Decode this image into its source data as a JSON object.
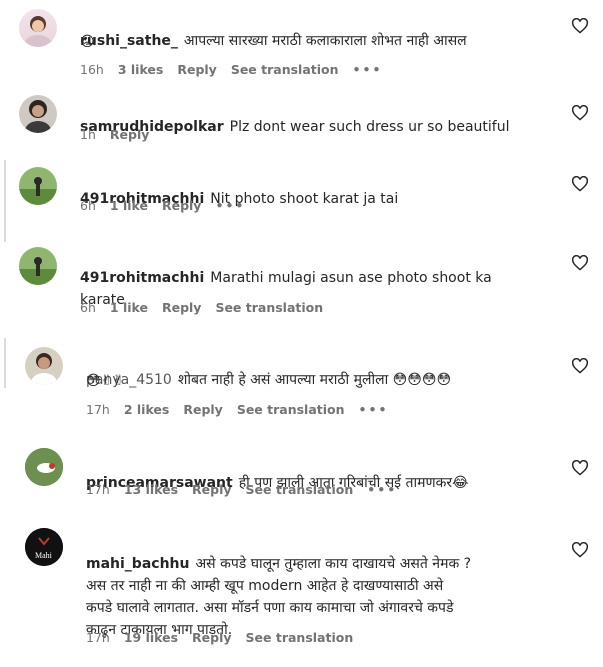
{
  "comments": [
    {
      "username": "rushi_sathe_",
      "text": "आपल्या सारख्या मराठी कलाकाराला शोभत नाही आसल",
      "emoji": "😡",
      "time": "16h",
      "likes": "3 likes",
      "reply": "Reply",
      "translate": "See translation",
      "more": "•••"
    },
    {
      "username": "samrudhidepolkar",
      "text": "Plz dont wear such dress ur so beautiful",
      "time": "1h",
      "reply": "Reply"
    },
    {
      "username": "491rohitmachhi",
      "text": "Nit photo shoot karat ja tai",
      "time": "6h",
      "likes": "1 like",
      "reply": "Reply",
      "more": "•••"
    },
    {
      "username": "491rohitmachhi",
      "text": "Marathi mulagi asun ase photo shoot ka\nkarate",
      "time": "6h",
      "likes": "1 like",
      "reply": "Reply",
      "translate": "See translation"
    },
    {
      "username": "panya_4510",
      "text": "शोबत नाही हे असं आपल्या मराठी मुलीला 😳😳😳😳",
      "emoji": "😳✌✌",
      "time": "17h",
      "likes": "2 likes",
      "reply": "Reply",
      "translate": "See translation",
      "more": "•••"
    },
    {
      "username": "princeamarsawant",
      "text": "ही पण झाली आता गरिबांची सई तामणकर😂",
      "time": "17h",
      "likes": "13 likes",
      "reply": "Reply",
      "translate": "See translation",
      "more": "•••"
    },
    {
      "username": "mahi_bachhu",
      "text": "असे कपडे घालून तुम्हाला काय दाखायचे असते नेमक ?\nअस तर नाही ना की आम्ही खूप modern आहेत हे दाखण्यासाठी असे\nकपडे घालावे लागतात. असा मॉडर्न पणा काय कामाचा जो अंगावरचे कपडे\nकाढून टाकायला भाग पाडतो.",
      "avatar_text": "Mahi",
      "time": "17h",
      "likes": "19 likes",
      "reply": "Reply",
      "translate": "See translation"
    }
  ],
  "colors": {
    "text": "#262626",
    "meta": "#737373",
    "divider": "#dbdbdb"
  }
}
